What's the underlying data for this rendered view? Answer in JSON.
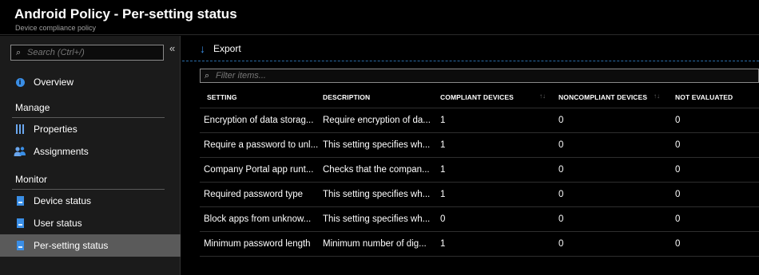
{
  "header": {
    "title": "Android Policy - Per-setting status",
    "subtitle": "Device compliance policy"
  },
  "sidebar": {
    "search_placeholder": "Search (Ctrl+/)",
    "collapse_glyph": "«",
    "overview": "Overview",
    "sections": {
      "manage": "Manage",
      "monitor": "Monitor"
    },
    "manage_items": [
      {
        "label": "Properties",
        "icon": "properties-icon"
      },
      {
        "label": "Assignments",
        "icon": "assignments-icon"
      }
    ],
    "monitor_items": [
      {
        "label": "Device status",
        "icon": "device-status-icon"
      },
      {
        "label": "User status",
        "icon": "user-status-icon"
      },
      {
        "label": "Per-setting status",
        "icon": "per-setting-status-icon",
        "active": true
      }
    ]
  },
  "toolbar": {
    "export_label": "Export"
  },
  "filter": {
    "placeholder": "Filter items..."
  },
  "table": {
    "columns": [
      "SETTING",
      "DESCRIPTION",
      "COMPLIANT DEVICES",
      "NONCOMPLIANT DEVICES",
      "NOT EVALUATED"
    ],
    "rows": [
      {
        "setting": "Encryption of data storag...",
        "description": "Require encryption of da...",
        "compliant": "1",
        "noncompliant": "0",
        "not_evaluated": "0"
      },
      {
        "setting": "Require a password to unl...",
        "description": "This setting specifies wh...",
        "compliant": "1",
        "noncompliant": "0",
        "not_evaluated": "0"
      },
      {
        "setting": "Company Portal app runt...",
        "description": "Checks that the compan...",
        "compliant": "1",
        "noncompliant": "0",
        "not_evaluated": "0"
      },
      {
        "setting": "Required password type",
        "description": "This setting specifies wh...",
        "compliant": "1",
        "noncompliant": "0",
        "not_evaluated": "0"
      },
      {
        "setting": "Block apps from unknow...",
        "description": "This setting specifies wh...",
        "compliant": "0",
        "noncompliant": "0",
        "not_evaluated": "0"
      },
      {
        "setting": "Minimum password length",
        "description": "Minimum number of dig...",
        "compliant": "1",
        "noncompliant": "0",
        "not_evaluated": "0"
      }
    ]
  },
  "colors": {
    "accent": "#3a8ee6",
    "active_nav": "#5a5a5a",
    "sidebar_bg": "#1b1b1b",
    "content_bg": "#000000"
  }
}
